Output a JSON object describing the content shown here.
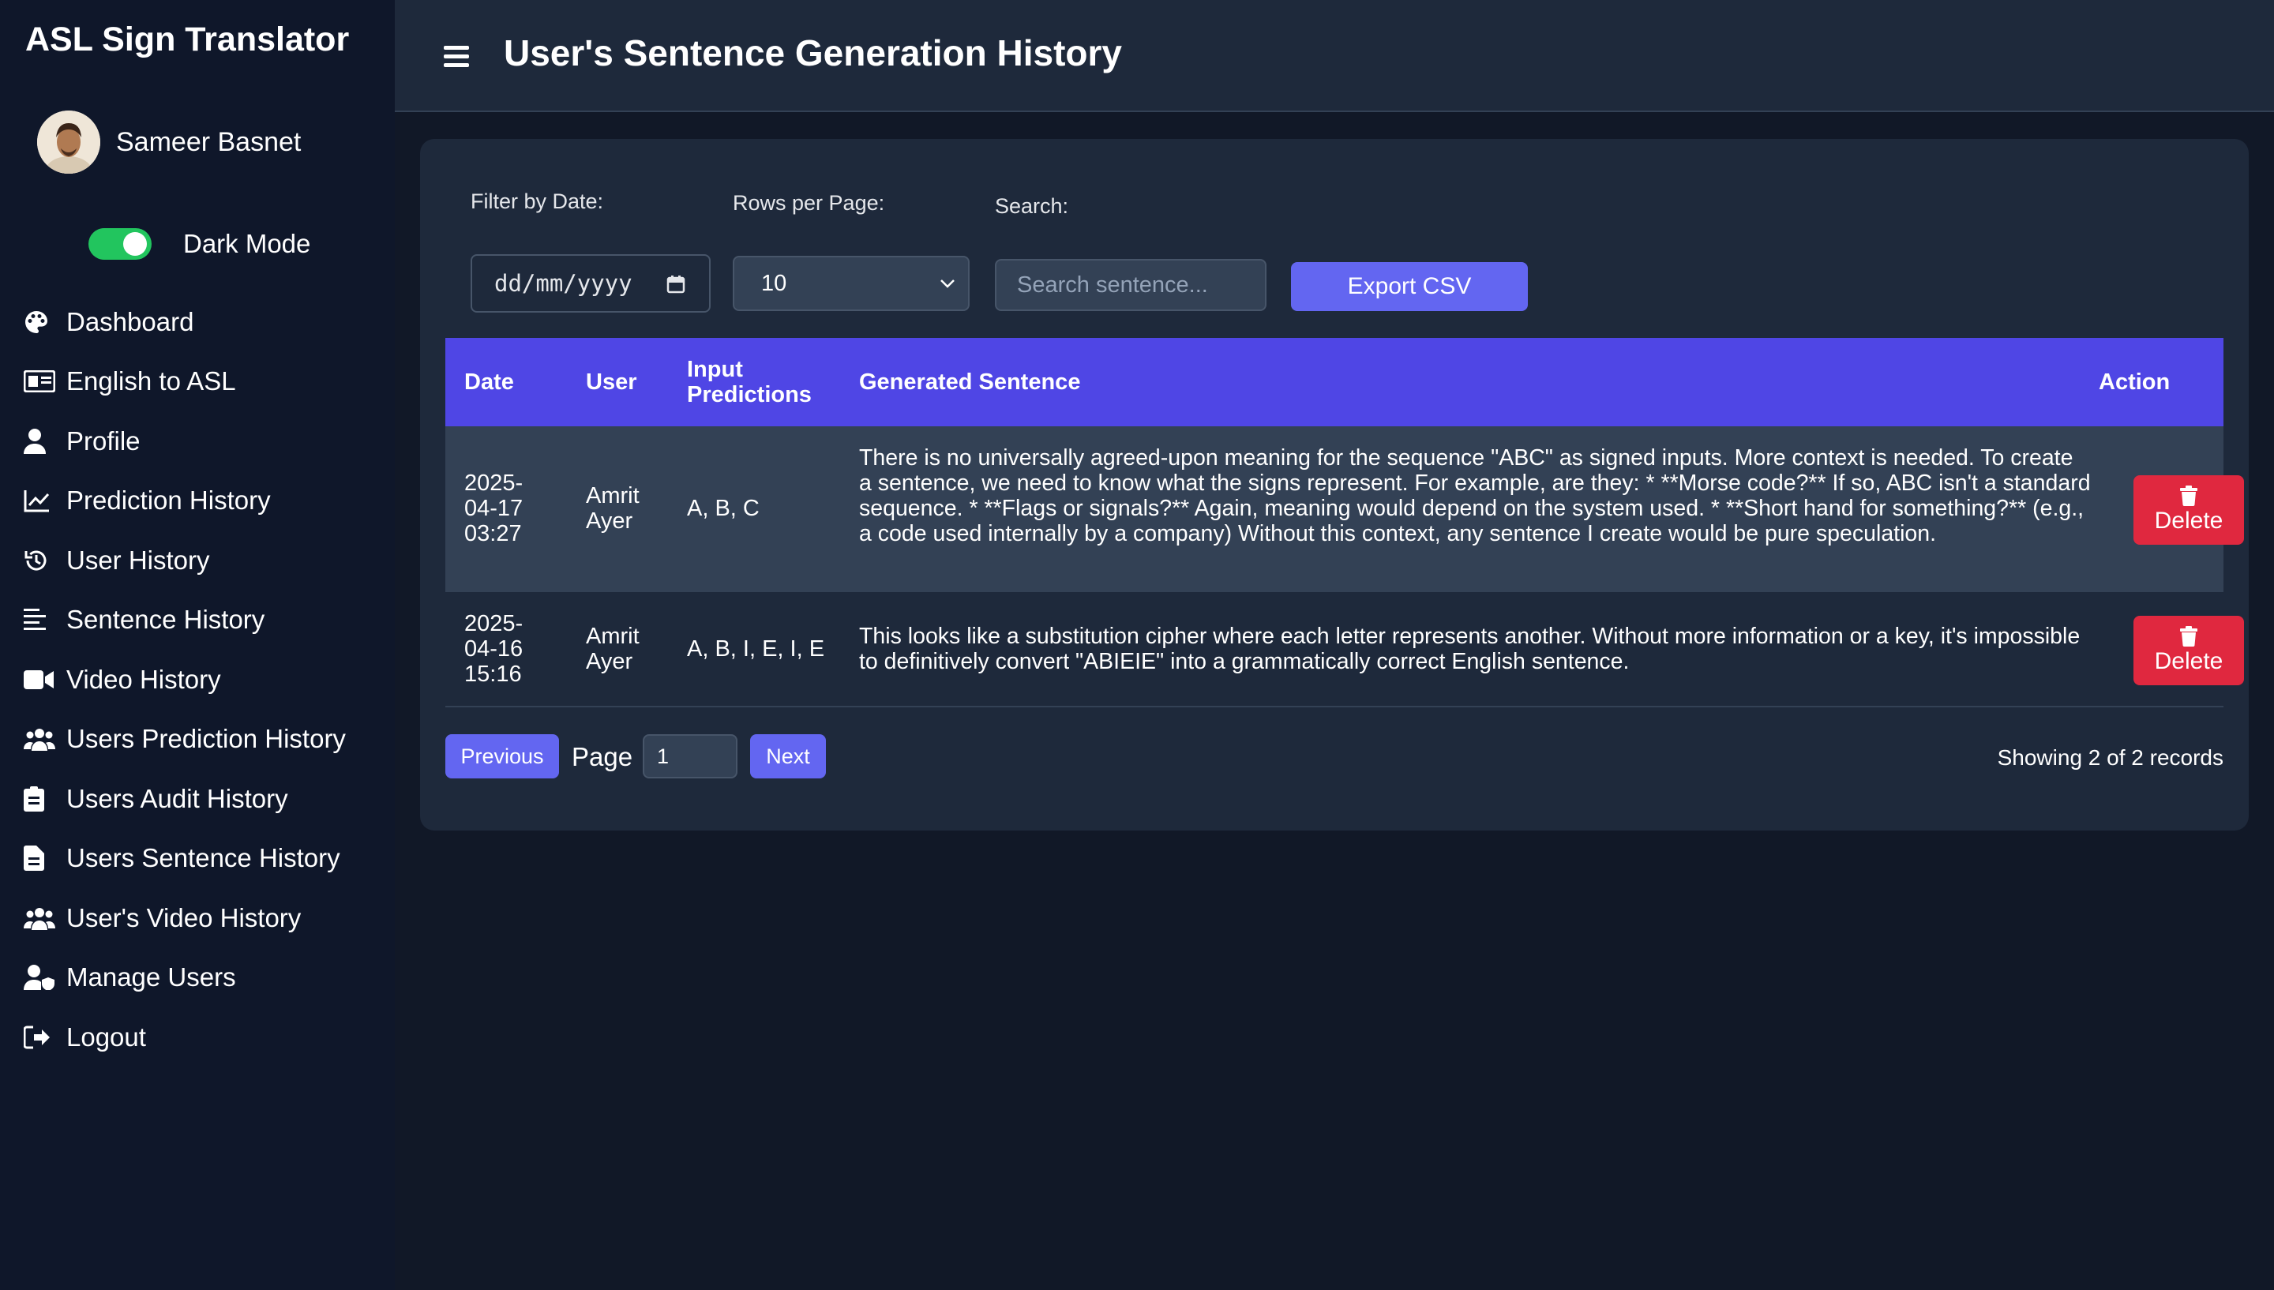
{
  "sidebar": {
    "brand": "ASL Sign Translator",
    "user_name": "Sameer Basnet",
    "dark_mode_label": "Dark Mode",
    "dark_mode_on": true,
    "items": [
      {
        "label": "Dashboard",
        "icon": "palette-icon"
      },
      {
        "label": "English to ASL",
        "icon": "id-card-icon"
      },
      {
        "label": "Profile",
        "icon": "user-icon"
      },
      {
        "label": "Prediction History",
        "icon": "line-chart-icon"
      },
      {
        "label": "User History",
        "icon": "history-icon"
      },
      {
        "label": "Sentence History",
        "icon": "align-left-icon"
      },
      {
        "label": "Video History",
        "icon": "video-icon"
      },
      {
        "label": "Users Prediction History",
        "icon": "users-icon"
      },
      {
        "label": "Users Audit History",
        "icon": "clipboard-icon"
      },
      {
        "label": "Users Sentence History",
        "icon": "file-icon"
      },
      {
        "label": "User's Video History",
        "icon": "users-icon"
      },
      {
        "label": "Manage Users",
        "icon": "user-shield-icon"
      },
      {
        "label": "Logout",
        "icon": "sign-out-icon"
      }
    ]
  },
  "header": {
    "title": "User's Sentence Generation History"
  },
  "filters": {
    "date_label": "Filter by Date:",
    "date_placeholder": "dd/mm/yyyy",
    "rows_label": "Rows per Page:",
    "rows_value": "10",
    "search_label": "Search:",
    "search_placeholder": "Search sentence...",
    "export_label": "Export CSV"
  },
  "table": {
    "headers": {
      "date": "Date",
      "user": "User",
      "input_line1": "Input",
      "input_line2": "Predictions",
      "sentence": "Generated Sentence",
      "action": "Action"
    },
    "rows": [
      {
        "date_l1": "2025-",
        "date_l2": "04-17",
        "date_l3": "03:27",
        "user_l1": "Amrit",
        "user_l2": "Ayer",
        "input": "A, B, C",
        "sentence": "There is no universally agreed-upon meaning for the sequence \"ABC\" as signed inputs. More context is needed. To create a sentence, we need to know what the signs represent. For example, are they: * **Morse code?** If so, ABC isn't a standard sequence. * **Flags or signals?** Again, meaning would depend on the system used. * **Short hand for something?** (e.g., a code used internally by a company) Without this context, any sentence I create would be pure speculation.",
        "action": "Delete"
      },
      {
        "date_l1": "2025-",
        "date_l2": "04-16",
        "date_l3": "15:16",
        "user_l1": "Amrit",
        "user_l2": "Ayer",
        "input": "A, B, I, E, I, E",
        "sentence": "This looks like a substitution cipher where each letter represents another. Without more information or a key, it's impossible to definitively convert \"ABIEIE\" into a grammatically correct English sentence.",
        "action": "Delete"
      }
    ]
  },
  "pagination": {
    "previous": "Previous",
    "page_label": "Page",
    "page_value": "1",
    "next": "Next",
    "showing": "Showing 2 of 2 records"
  },
  "colors": {
    "accent": "#6366f1",
    "table_header": "#4f46e5",
    "delete": "#e0283f",
    "toggle_on": "#22c55e"
  }
}
